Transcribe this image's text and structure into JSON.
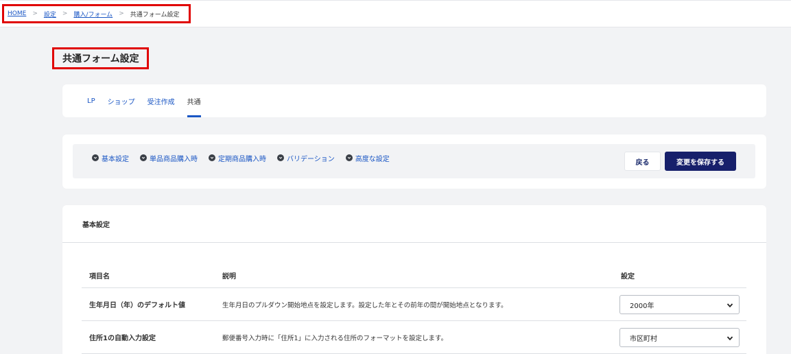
{
  "breadcrumb": {
    "items": [
      {
        "label": "HOME"
      },
      {
        "label": "設定"
      },
      {
        "label": "購入/フォーム"
      }
    ],
    "separator": ">",
    "current": "共通フォーム設定"
  },
  "page": {
    "title": "共通フォーム設定"
  },
  "tabs": [
    {
      "label": "LP",
      "active": false
    },
    {
      "label": "ショップ",
      "active": false
    },
    {
      "label": "受注作成",
      "active": false
    },
    {
      "label": "共通",
      "active": true
    }
  ],
  "anchors": [
    {
      "label": "基本設定",
      "icon": "chevron-down-circle-icon"
    },
    {
      "label": "単品商品購入時",
      "icon": "chevron-down-circle-icon"
    },
    {
      "label": "定期商品購入時",
      "icon": "chevron-down-circle-icon"
    },
    {
      "label": "バリデーション",
      "icon": "chevron-down-circle-icon"
    },
    {
      "label": "高度な設定",
      "icon": "chevron-down-circle-icon"
    }
  ],
  "actions": {
    "back_label": "戻る",
    "save_label": "変更を保存する"
  },
  "section": {
    "title": "基本設定",
    "columns": {
      "name": "項目名",
      "description": "説明",
      "setting": "設定"
    },
    "rows": [
      {
        "name": "生年月日（年）のデフォルト値",
        "description": "生年月日のプルダウン開始地点を設定します。設定した年とその前年の間が開始地点となります。",
        "value": "2000年"
      },
      {
        "name": "住所1の自動入力設定",
        "description": "郵便番号入力時に「住所1」に入力される住所のフォーマットを設定します。",
        "value": "市区町村"
      }
    ]
  },
  "colors": {
    "link": "#1a56c4",
    "primary_button": "#17206b",
    "highlight_box": "#e00000",
    "background": "#f2f3f5"
  }
}
